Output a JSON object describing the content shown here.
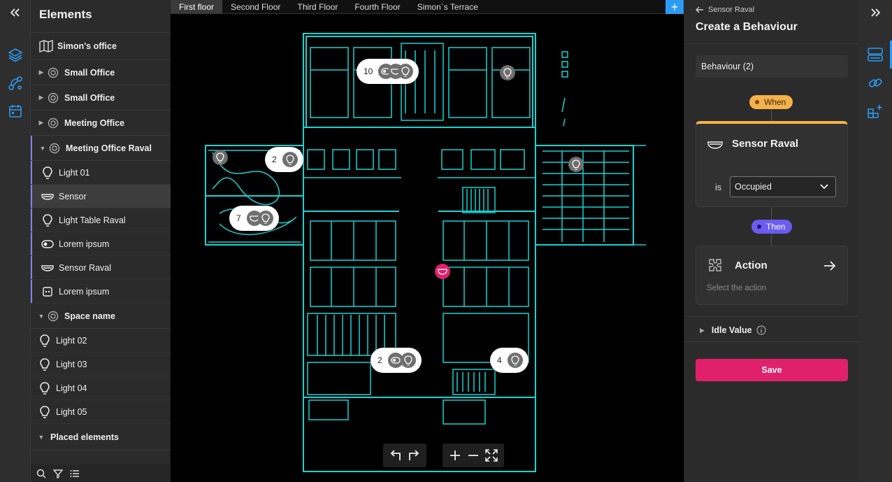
{
  "left_rail": {
    "collapse_icon": "double-chevron-left-icon",
    "buttons": [
      "layers-icon",
      "graph-nodes-icon",
      "calendar-icon"
    ]
  },
  "elements_panel": {
    "title": "Elements",
    "root": {
      "label": "Simon's office",
      "icon": "map-icon"
    },
    "spaces": [
      {
        "label": "Small Office",
        "expanded": false
      },
      {
        "label": "Small Office",
        "expanded": false
      },
      {
        "label": "Meeting Office",
        "expanded": false
      },
      {
        "label": "Meeting Office Raval",
        "expanded": true,
        "children": [
          {
            "label": "Light 01",
            "icon": "lightbulb-icon"
          },
          {
            "label": "Sensor",
            "icon": "sensor-icon",
            "selected": true
          },
          {
            "label": "Light Table Raval",
            "icon": "lightbulb-icon"
          },
          {
            "label": "Lorem ipsum",
            "icon": "toggle-icon"
          },
          {
            "label": "Sensor Raval",
            "icon": "sensor-icon"
          },
          {
            "label": "Lorem ipsum",
            "icon": "socket-icon"
          }
        ]
      },
      {
        "label": "Space name",
        "expanded": true,
        "children": [
          {
            "label": "Light 02",
            "icon": "lightbulb-icon"
          },
          {
            "label": "Light 03",
            "icon": "lightbulb-icon"
          },
          {
            "label": "Light 04",
            "icon": "lightbulb-icon"
          },
          {
            "label": "Light 05",
            "icon": "lightbulb-icon"
          }
        ]
      }
    ],
    "placed_elements": {
      "label": "Placed elements",
      "expanded": true
    },
    "footer_icons": [
      "search-icon",
      "filter-icon",
      "list-icon"
    ]
  },
  "map": {
    "tabs": [
      {
        "label": "First floor",
        "active": true
      },
      {
        "label": "Second Floor",
        "active": false
      },
      {
        "label": "Third Floor",
        "active": false
      },
      {
        "label": "Fourth Floor",
        "active": false
      },
      {
        "label": "Simon`s Terrace",
        "active": false
      }
    ],
    "add_tab_label": "+",
    "clusters": [
      {
        "count": "10",
        "icons": [
          "toggle-icon",
          "sensor-icon",
          "lightbulb-icon"
        ]
      },
      {
        "count": "2",
        "icons": [
          "lightbulb-icon"
        ]
      },
      {
        "count": "7",
        "icons": [
          "sensor-icon",
          "lightbulb-icon"
        ]
      },
      {
        "count": "2",
        "icons": [
          "toggle-icon",
          "lightbulb-icon"
        ]
      },
      {
        "count": "4",
        "icons": [
          "lightbulb-icon"
        ]
      }
    ],
    "controls": [
      "undo-icon",
      "redo-icon",
      "zoom-in-icon",
      "zoom-out-icon",
      "fit-screen-icon"
    ]
  },
  "behaviour_panel": {
    "back_label": "Sensor Raval",
    "title": "Create a Behaviour",
    "name_value": "Behaviour (2)",
    "when_label": "When",
    "when_color": "#f5b14a",
    "trigger": {
      "device": "Sensor Raval",
      "condition_label": "is",
      "condition_value": "Occupied"
    },
    "then_label": "Then",
    "then_color": "#6b5cf0",
    "action": {
      "title": "Action",
      "hint": "Select the action"
    },
    "idle_value_label": "Idle Value",
    "save_label": "Save",
    "accent": "#e0206b"
  },
  "right_rail": {
    "expand_icon": "double-chevron-right-icon",
    "buttons": [
      "devices-panel-icon",
      "link-icon",
      "grid-plus-icon"
    ]
  }
}
